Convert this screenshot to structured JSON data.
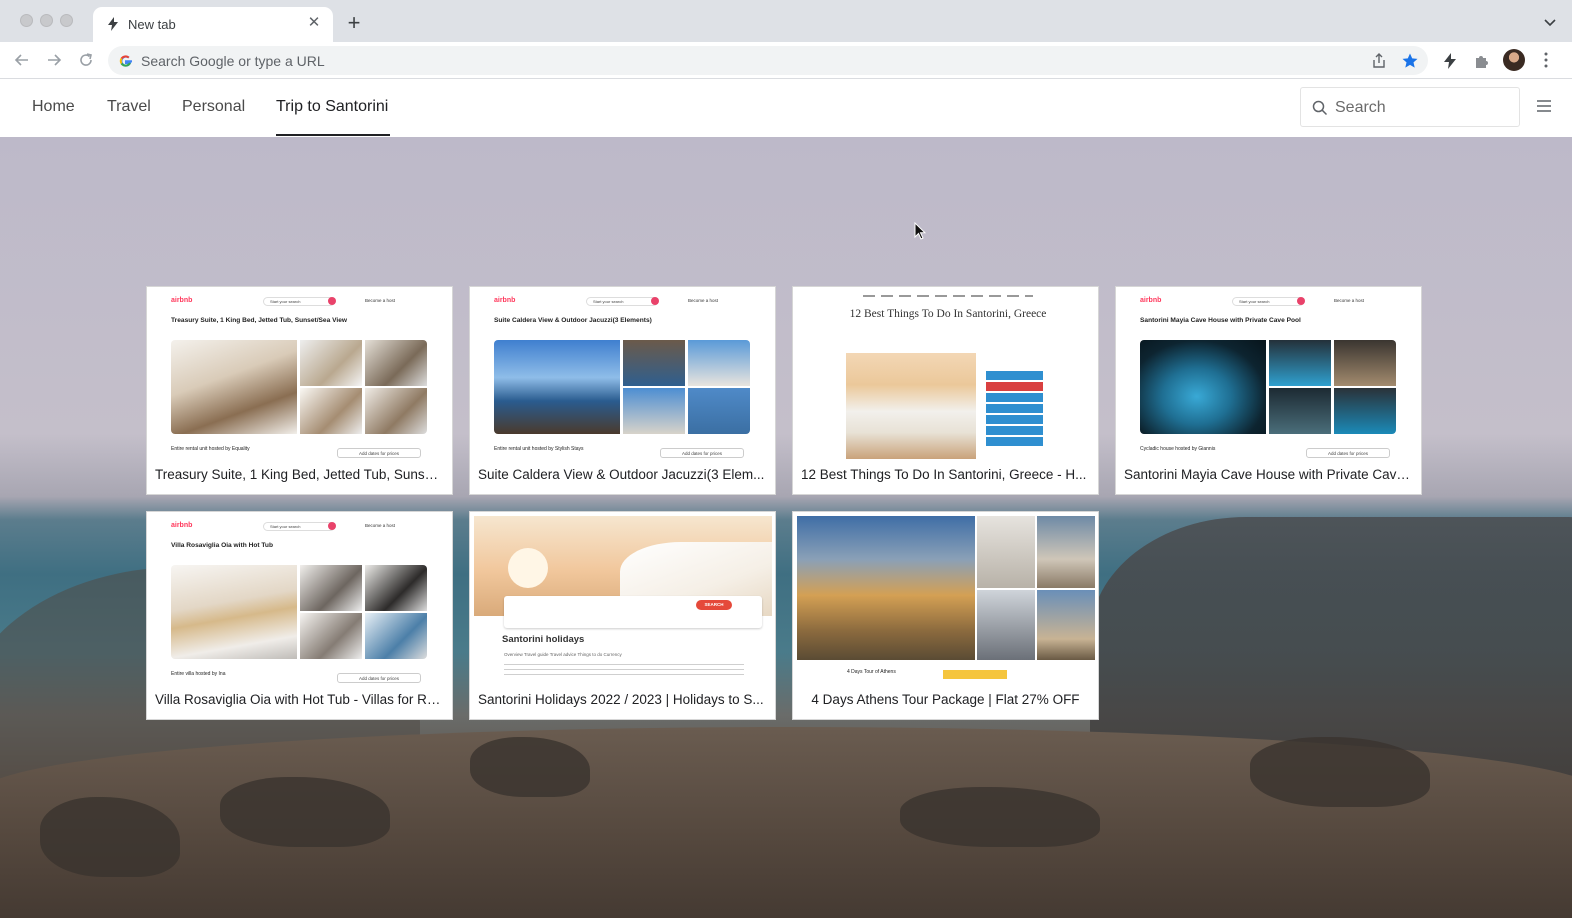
{
  "browser": {
    "tab_title": "New tab",
    "omnibox_placeholder": "Search Google or type a URL"
  },
  "nav": {
    "links": [
      "Home",
      "Travel",
      "Personal",
      "Trip to Santorini"
    ],
    "active_link": "Trip to Santorini",
    "search_placeholder": "Search"
  },
  "colors": {
    "active_underline": "#202124",
    "bookmark_star": "#1a73e8",
    "airbnb_brand": "#ff385c"
  },
  "icons": [
    "bolt-icon",
    "close-icon",
    "plus-icon",
    "chevron-down-icon",
    "back-arrow-icon",
    "forward-arrow-icon",
    "reload-icon",
    "google-icon",
    "share-icon",
    "star-icon",
    "extensions-icon",
    "kebab-menu-icon",
    "search-icon",
    "hamburger-icon"
  ],
  "cards": [
    {
      "title": "Treasury Suite, 1 King Bed, Jetted Tub, Sunset...",
      "thumb": {
        "logo": "airbnb",
        "search": "Start your search",
        "host_link": "Become a host",
        "listing": "Treasury Suite, 1 King Bed, Jetted Tub, Sunset/Sea View",
        "hosted": "Entire rental unit hosted by Equality",
        "price_btn": "Add dates for prices"
      }
    },
    {
      "title": "Suite Caldera View & Outdoor Jacuzzi(3 Elem...",
      "thumb": {
        "logo": "airbnb",
        "search": "Start your search",
        "host_link": "Become a host",
        "listing": "Suite Caldera View & Outdoor Jacuzzi(3 Elements)",
        "hosted": "Entire rental unit hosted by Stylish Stays",
        "price_btn": "Add dates for prices"
      }
    },
    {
      "title": "12 Best Things To Do In Santorini, Greece - H...",
      "thumb": {
        "heading": "12 Best Things To Do In Santorini, Greece"
      }
    },
    {
      "title": "Santorini Mayia Cave House with Private Cave...",
      "thumb": {
        "logo": "airbnb",
        "search": "Start your search",
        "host_link": "Become a host",
        "listing": "Santorini Mayia Cave House with Private Cave Pool",
        "hosted": "Cycladic house hosted by Giannis",
        "price_btn": "Add dates for prices"
      }
    },
    {
      "title": "Villa Rosaviglia Oia with Hot Tub - Villas for Re...",
      "thumb": {
        "logo": "airbnb",
        "search": "Start your search",
        "host_link": "Become a host",
        "listing": "Villa Rosaviglia Oia with Hot Tub",
        "hosted": "Entire villa hosted by Ina",
        "price_btn": "Add dates for prices"
      }
    },
    {
      "title": "Santorini Holidays 2022 / 2023 | Holidays to S...",
      "thumb": {
        "heading": "Santorini holidays",
        "search_btn": "SEARCH",
        "tabs": "Overview   Travel guide   Travel advice   Things to do   Currency"
      }
    },
    {
      "title": "4 Days Athens Tour Package | Flat 27% OFF",
      "thumb": {
        "label": "4 Days Tour of Athens"
      }
    }
  ]
}
